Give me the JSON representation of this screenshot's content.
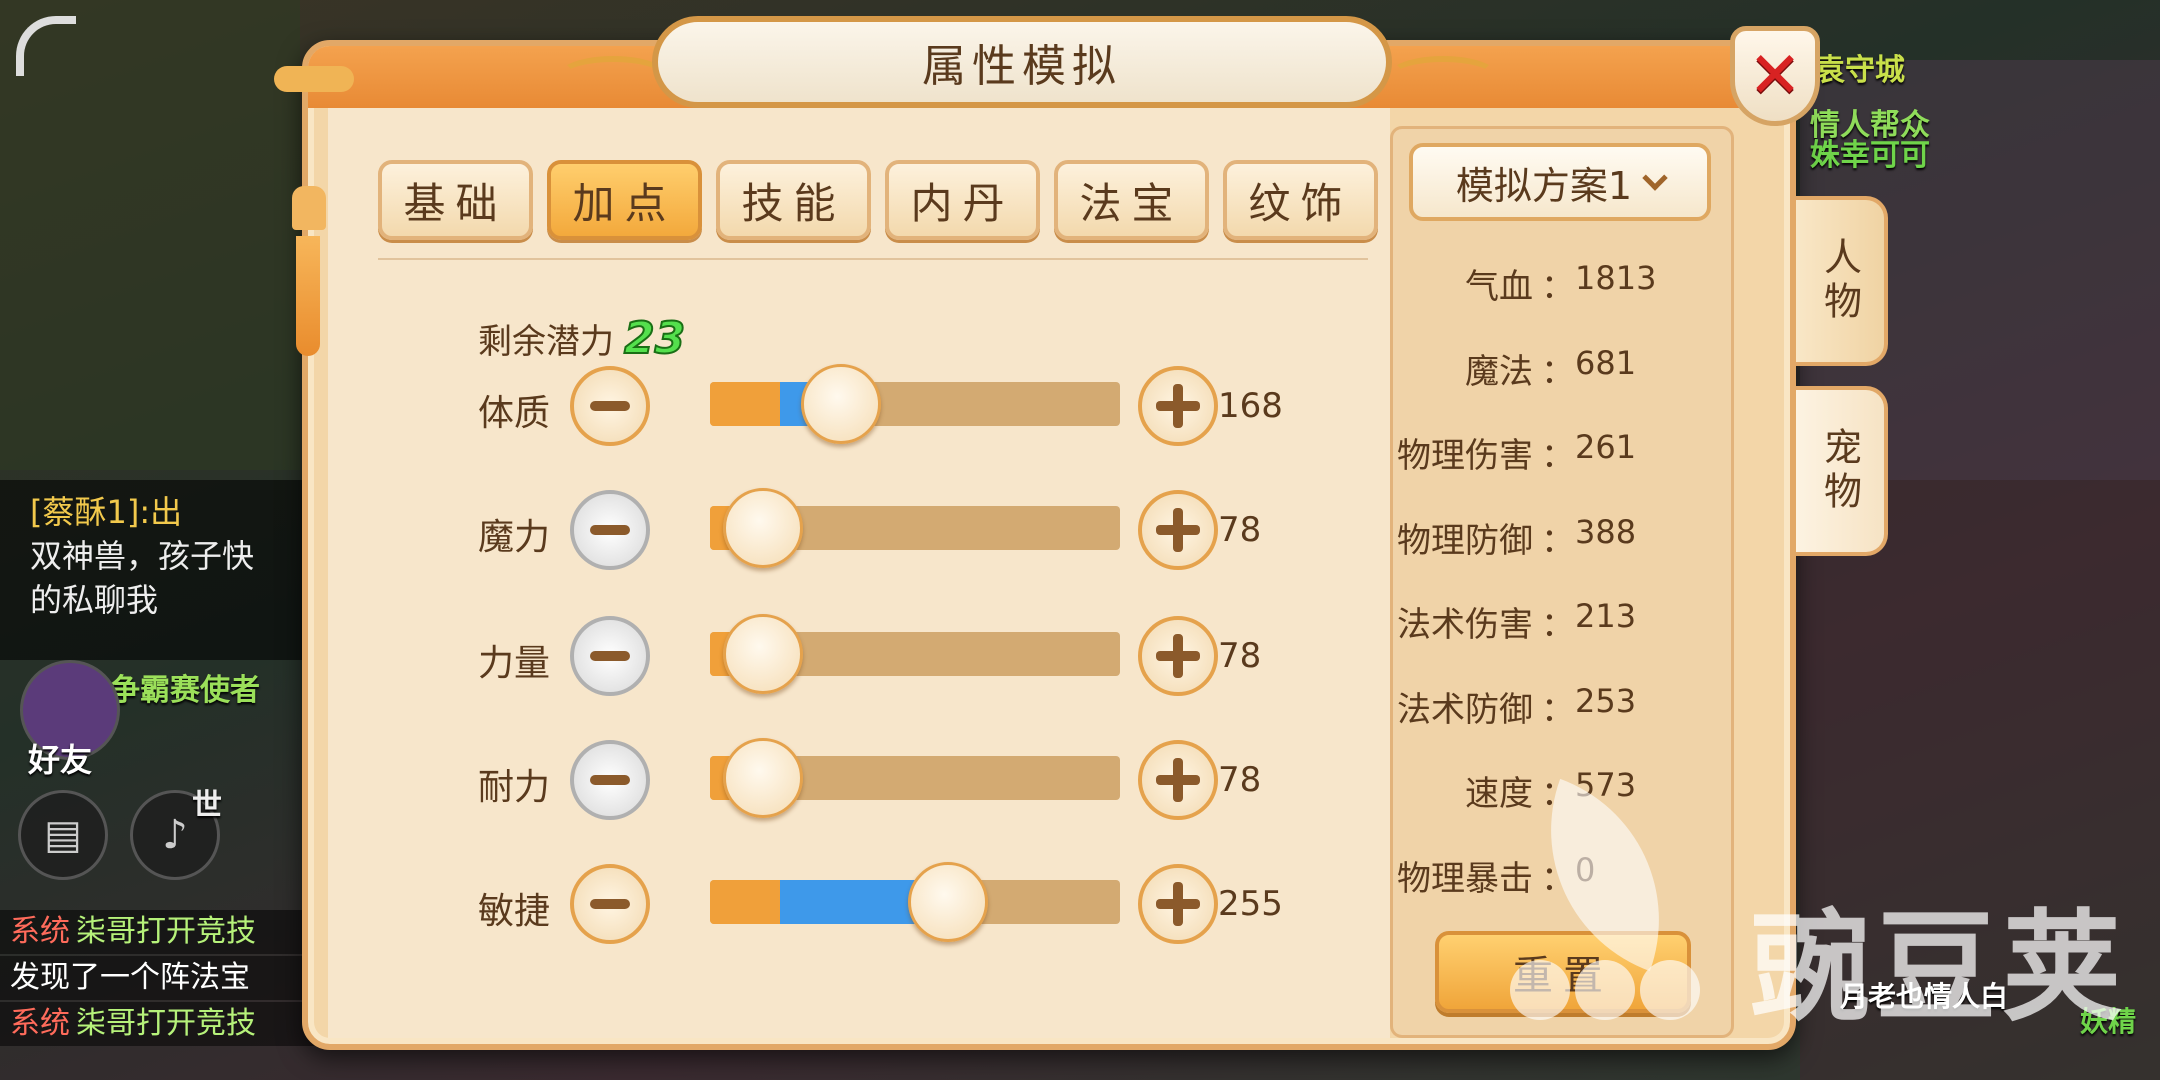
{
  "background": {
    "scene_labels": [
      "袁守城",
      "情人帮众",
      "姝幸可可",
      "争霸赛使者",
      "好友",
      "世",
      "月老也情人白",
      "妖精"
    ],
    "chat": {
      "speaker": "[蔡酥1]",
      "lines": [
        "[蔡酥1]:出",
        "双神兽，孩子快",
        "的私聊我"
      ]
    },
    "system_lines": [
      {
        "tag": "系统",
        "text": "柒哥打开竞技"
      },
      {
        "tag": "",
        "text": "发现了一个阵法宝"
      },
      {
        "tag": "系统",
        "text": "柒哥打开竞技"
      }
    ]
  },
  "modal": {
    "title": "属性模拟",
    "close_icon": "close-icon",
    "tabs": [
      {
        "label": "基础",
        "active": false
      },
      {
        "label": "加点",
        "active": true
      },
      {
        "label": "技能",
        "active": false
      },
      {
        "label": "内丹",
        "active": false
      },
      {
        "label": "法宝",
        "active": false
      },
      {
        "label": "纹饰",
        "active": false
      }
    ],
    "potential_label": "剩余潜力",
    "potential_value": "23",
    "attributes": [
      {
        "label": "体质",
        "value": "168",
        "base_fraction": 0.17,
        "added_fraction": 0.1,
        "minus_enabled": true
      },
      {
        "label": "魔力",
        "value": "78",
        "base_fraction": 0.08,
        "added_fraction": 0.0,
        "minus_enabled": false
      },
      {
        "label": "力量",
        "value": "78",
        "base_fraction": 0.08,
        "added_fraction": 0.0,
        "minus_enabled": false
      },
      {
        "label": "耐力",
        "value": "78",
        "base_fraction": 0.08,
        "added_fraction": 0.0,
        "minus_enabled": false
      },
      {
        "label": "敏捷",
        "value": "255",
        "base_fraction": 0.17,
        "added_fraction": 0.36,
        "minus_enabled": true
      }
    ],
    "scheme_select": {
      "value": "模拟方案1"
    },
    "stats": [
      {
        "name": "气血",
        "value": "1813"
      },
      {
        "name": "魔法",
        "value": "681"
      },
      {
        "name": "物理伤害",
        "value": "261"
      },
      {
        "name": "物理防御",
        "value": "388"
      },
      {
        "name": "法术伤害",
        "value": "213"
      },
      {
        "name": "法术防御",
        "value": "253"
      },
      {
        "name": "速度",
        "value": "573"
      },
      {
        "name": "物理暴击",
        "value": "0"
      }
    ],
    "stat_separator": "：",
    "reset_label": "重置",
    "side_tabs": [
      {
        "label": "人物",
        "active": false
      },
      {
        "label": "宠物",
        "active": true
      }
    ]
  },
  "watermark": {
    "text": "豌豆荚"
  },
  "colors": {
    "base_fill": "#f0a03a",
    "added_fill": "#3e99ea",
    "track": "#d3aa72",
    "potential_green": "#54e04d",
    "close_red": "#d82222"
  }
}
